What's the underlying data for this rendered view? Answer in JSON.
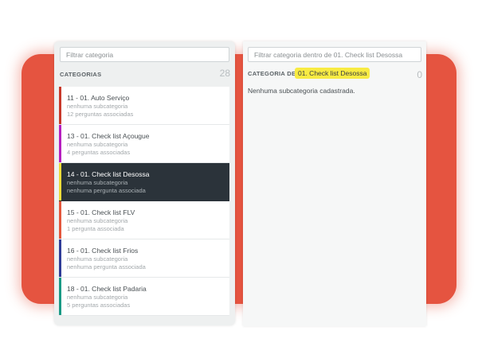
{
  "categories_panel": {
    "filter_placeholder": "Filtrar categoria",
    "header_label": "CATEGORIAS",
    "count": "28",
    "items": [
      {
        "title": "11 - 01. Auto Serviço",
        "subcategory": "nenhuma subcategoria",
        "questions": "12 perguntas associadas",
        "color": "#c8392b"
      },
      {
        "title": "13 - 01. Check list Açougue",
        "subcategory": "nenhuma subcategoria",
        "questions": "4 perguntas associadas",
        "color": "#b61fbf"
      },
      {
        "title": "14 - 01. Check list Desossa",
        "subcategory": "nenhuma subcategoria",
        "questions": "nenhuma pergunta associada",
        "color": "#f1dd3a"
      },
      {
        "title": "15 - 01. Check list FLV",
        "subcategory": "nenhuma subcategoria",
        "questions": "1 pergunta associada",
        "color": "#e4573c"
      },
      {
        "title": "16 - 01. Check list Frios",
        "subcategory": "nenhuma subcategoria",
        "questions": "nenhuma pergunta associada",
        "color": "#2f3c98"
      },
      {
        "title": "18 - 01. Check list Padaria",
        "subcategory": "nenhuma subcategoria",
        "questions": "5 perguntas associadas",
        "color": "#1a9a85"
      }
    ],
    "selected_index": 2
  },
  "subcategories_panel": {
    "filter_placeholder": "Filtrar categoria dentro de 01. Check list Desossa",
    "header_label": "CATEGORIA DE :",
    "selected_category": "01. Check list Desossa",
    "count": "0",
    "empty_message": "Nenhuma subcategoria cadastrada.",
    "badge_color": "#f8eb43"
  },
  "colors": {
    "accent_backdrop": "#e55440",
    "selected_row": "#2b333a"
  }
}
